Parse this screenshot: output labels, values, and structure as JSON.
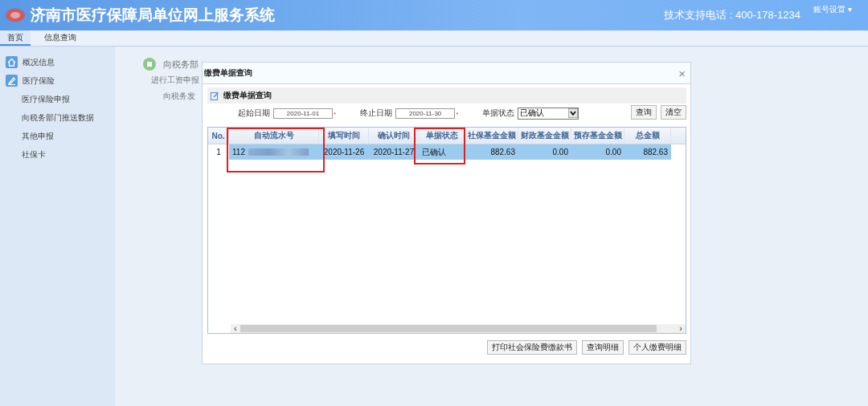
{
  "header": {
    "title": "济南市医疗保障局单位网上服务系统",
    "support": "技术支持电话 : 400-178-1234",
    "account_menu": "账号设置",
    "account_caret": "▾"
  },
  "tabs": [
    {
      "label": "首页",
      "selected": true
    },
    {
      "label": "信息查询",
      "selected": false
    }
  ],
  "sidebar": {
    "items": [
      {
        "label": "概况信息",
        "kind": "heading"
      },
      {
        "label": "医疗保险",
        "kind": "heading"
      },
      {
        "label": "医疗保险申报",
        "kind": "link"
      },
      {
        "label": "向税务部门推送数据",
        "kind": "link"
      },
      {
        "label": "其他申报",
        "kind": "link"
      },
      {
        "label": "社保卡",
        "kind": "link"
      }
    ]
  },
  "background_panel": {
    "title": "向税务部",
    "line_1": "进行工资申报",
    "line_2": "向税务发"
  },
  "dialog": {
    "title": "缴费单据查询",
    "close": "×",
    "section_title": "缴费单据查询",
    "filters": [
      {
        "label": "起始日期",
        "value": "2020-11-01",
        "required": "*",
        "kind": "date"
      },
      {
        "label": "终止日期",
        "value": "2020-11-30",
        "required": "*",
        "kind": "date"
      },
      {
        "label": "单据状态",
        "value": "已确认",
        "kind": "select"
      }
    ],
    "query_buttons": [
      "查询",
      "清空"
    ],
    "table": {
      "columns": [
        "No.",
        "自动流水号",
        "填写时间",
        "确认时间",
        "单据状态",
        "社保基金金额",
        "财政基金金额",
        "预存基金金额",
        "总金额"
      ],
      "rows": [
        {
          "selected": true,
          "cells": [
            "1",
            "112",
            "2020-11-26",
            "2020-11-27",
            "已确认",
            "882.63",
            "0.00",
            "0.00",
            "882.63"
          ]
        }
      ]
    },
    "scroll_left": "‹",
    "scroll_right": "›",
    "action_buttons": [
      "打印社会保险费缴款书",
      "查询明细",
      "个人缴费明细"
    ]
  }
}
